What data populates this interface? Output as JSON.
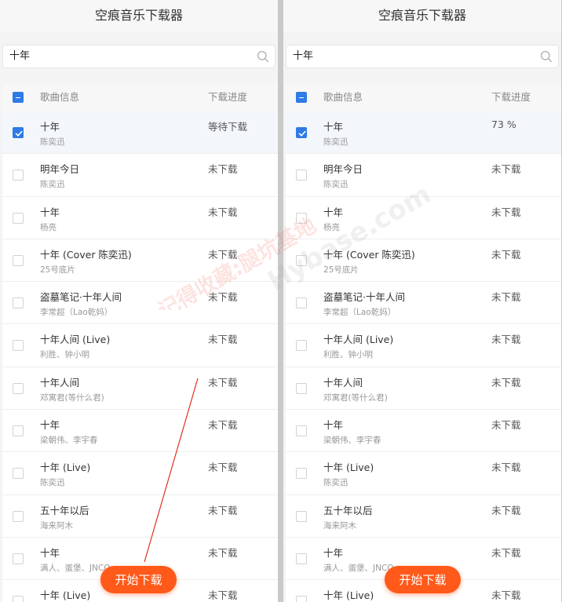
{
  "left": {
    "title": "空痕音乐下载器",
    "search_value": "十年",
    "header": {
      "info": "歌曲信息",
      "progress": "下载进度"
    },
    "songs": [
      {
        "name": "十年",
        "artist": "陈奕迅",
        "progress": "等待下载",
        "checked": true
      },
      {
        "name": "明年今日",
        "artist": "陈奕迅",
        "progress": "未下载",
        "checked": false
      },
      {
        "name": "十年",
        "artist": "杨亮",
        "progress": "未下载",
        "checked": false
      },
      {
        "name": "十年 (Cover 陈奕迅)",
        "artist": "25号底片",
        "progress": "未下载",
        "checked": false
      },
      {
        "name": "盗墓笔记·十年人间",
        "artist": "李常超（Lao乾妈）",
        "progress": "未下载",
        "checked": false
      },
      {
        "name": "十年人间 (Live)",
        "artist": "利胜、钟小明",
        "progress": "未下载",
        "checked": false
      },
      {
        "name": "十年人间",
        "artist": "邓寓君(等什么君)",
        "progress": "未下载",
        "checked": false
      },
      {
        "name": "十年",
        "artist": "梁朝伟、李宇春",
        "progress": "未下载",
        "checked": false
      },
      {
        "name": "十年 (Live)",
        "artist": "陈奕迅",
        "progress": "未下载",
        "checked": false
      },
      {
        "name": "五十年以后",
        "artist": "海来阿木",
        "progress": "未下载",
        "checked": false
      },
      {
        "name": "十年",
        "artist": "满人、蛋堡、JNCO",
        "progress": "未下载",
        "checked": false
      },
      {
        "name": "十年 (Live)",
        "artist": "",
        "progress": "未下载",
        "checked": false
      }
    ],
    "start_button": "开始下载"
  },
  "right": {
    "title": "空痕音乐下载器",
    "search_value": "十年",
    "header": {
      "info": "歌曲信息",
      "progress": "下载进度"
    },
    "songs": [
      {
        "name": "十年",
        "artist": "陈奕迅",
        "progress": "73 %",
        "checked": true
      },
      {
        "name": "明年今日",
        "artist": "陈奕迅",
        "progress": "未下载",
        "checked": false
      },
      {
        "name": "十年",
        "artist": "杨亮",
        "progress": "未下载",
        "checked": false
      },
      {
        "name": "十年 (Cover 陈奕迅)",
        "artist": "25号底片",
        "progress": "未下载",
        "checked": false
      },
      {
        "name": "盗墓笔记·十年人间",
        "artist": "李常超（Lao乾妈）",
        "progress": "未下载",
        "checked": false
      },
      {
        "name": "十年人间 (Live)",
        "artist": "利胜、钟小明",
        "progress": "未下载",
        "checked": false
      },
      {
        "name": "十年人间",
        "artist": "邓寓君(等什么君)",
        "progress": "未下载",
        "checked": false
      },
      {
        "name": "十年",
        "artist": "梁朝伟、李宇春",
        "progress": "未下载",
        "checked": false
      },
      {
        "name": "十年 (Live)",
        "artist": "陈奕迅",
        "progress": "未下载",
        "checked": false
      },
      {
        "name": "五十年以后",
        "artist": "海来阿木",
        "progress": "未下载",
        "checked": false
      },
      {
        "name": "十年",
        "artist": "满人、蛋堡、JNCO",
        "progress": "未下载",
        "checked": false
      },
      {
        "name": "十年 (Live)",
        "artist": "",
        "progress": "未下载",
        "checked": false
      }
    ],
    "start_button": "开始下载"
  },
  "watermark": {
    "cn": "记得收藏:腿坑基地",
    "en": "Hybase.com"
  },
  "colors": {
    "accent": "#2f7ae5",
    "button": "#ff5a1a",
    "annotation": "#e03020"
  }
}
